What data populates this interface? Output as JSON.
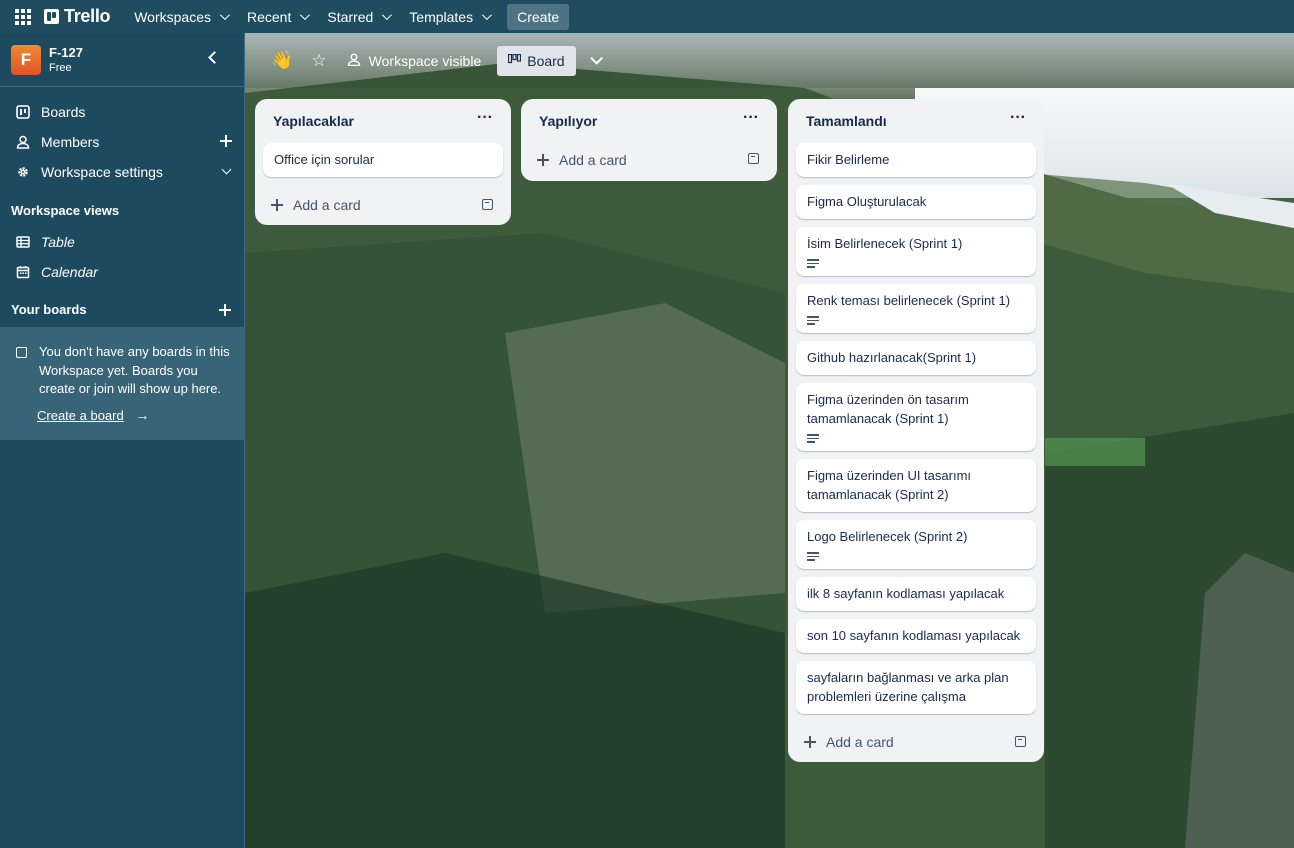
{
  "topbar": {
    "app_name": "Trello",
    "menus": [
      {
        "label": "Workspaces"
      },
      {
        "label": "Recent"
      },
      {
        "label": "Starred"
      },
      {
        "label": "Templates"
      }
    ],
    "create_label": "Create"
  },
  "sidebar": {
    "workspace": {
      "initial": "F",
      "name": "F-127",
      "plan": "Free"
    },
    "items": [
      {
        "label": "Boards"
      },
      {
        "label": "Members"
      },
      {
        "label": "Workspace settings"
      }
    ],
    "views_heading": "Workspace views",
    "views": [
      {
        "label": "Table"
      },
      {
        "label": "Calendar"
      }
    ],
    "your_boards_heading": "Your boards",
    "empty_message": "You don't have any boards in this Workspace yet. Boards you create or join will show up here.",
    "create_board_link": "Create a board"
  },
  "board_header": {
    "emoji": "👋",
    "visibility_label": "Workspace visible",
    "view_button_label": "Board"
  },
  "lists": [
    {
      "title": "Yapılacaklar",
      "cards": [
        {
          "title": "Office için sorular",
          "has_description": false
        }
      ],
      "add_card_label": "Add a card"
    },
    {
      "title": "Yapılıyor",
      "cards": [],
      "add_card_label": "Add a card"
    },
    {
      "title": "Tamamlandı",
      "cards": [
        {
          "title": "Fikir Belirleme",
          "has_description": false
        },
        {
          "title": "Figma Oluşturulacak",
          "has_description": false
        },
        {
          "title": "İsim Belirlenecek (Sprint 1)",
          "has_description": true
        },
        {
          "title": "Renk teması belirlenecek (Sprint 1)",
          "has_description": true
        },
        {
          "title": "Github hazırlanacak(Sprint 1)",
          "has_description": false
        },
        {
          "title": "Figma üzerinden ön tasarım tamamlanacak (Sprint 1)",
          "has_description": true
        },
        {
          "title": "Figma üzerinden UI tasarımı tamamlanacak (Sprint 2)",
          "has_description": false
        },
        {
          "title": "Logo Belirlenecek (Sprint 2)",
          "has_description": true
        },
        {
          "title": "ilk 8 sayfanın kodlaması yapılacak",
          "has_description": false
        },
        {
          "title": "son 10 sayfanın kodlaması yapılacak",
          "has_description": false
        },
        {
          "title": "sayfaların bağlanması ve arka plan problemleri üzerine çalışma",
          "has_description": false
        }
      ],
      "add_card_label": "Add a card"
    }
  ]
}
